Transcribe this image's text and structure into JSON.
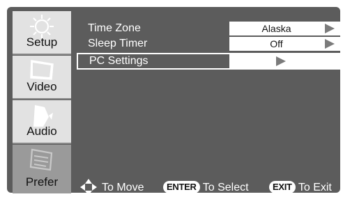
{
  "sidebar": {
    "items": [
      {
        "label": "Setup",
        "icon": "gear-icon"
      },
      {
        "label": "Video",
        "icon": "monitor-icon"
      },
      {
        "label": "Audio",
        "icon": "speaker-icon"
      },
      {
        "label": "Prefer",
        "icon": "preferences-icon",
        "selected": true
      }
    ]
  },
  "menu": {
    "rows": [
      {
        "label": "Time Zone",
        "value": "Alaska"
      },
      {
        "label": "Sleep Timer",
        "value": "Off"
      },
      {
        "label": "PC Settings",
        "value": ""
      }
    ]
  },
  "footer": {
    "move_text": "To Move",
    "enter_key": "ENTER",
    "select_text": "To Select",
    "exit_key": "EXIT",
    "exit_text": "To Exit"
  },
  "colors": {
    "panel": "#5c5c5c",
    "sidebar": "#e2e2e2",
    "sidebar_selected": "#9a9a9a",
    "text": "#ffffff"
  }
}
